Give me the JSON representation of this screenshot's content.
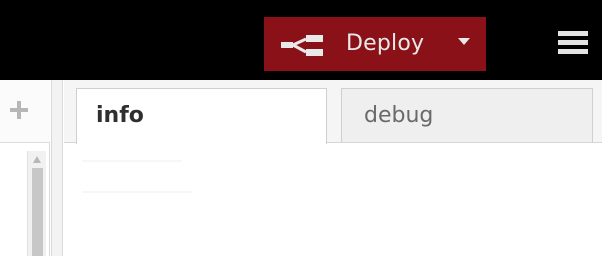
{
  "header": {
    "deploy": {
      "label": "Deploy",
      "icon": "deploy-icon",
      "dropdown_icon": "caret-down-icon",
      "background_color": "#8b1118"
    },
    "menu_icon": "hamburger-menu-icon",
    "background_color": "#000000"
  },
  "workspace": {
    "add_icon": "plus-icon",
    "scroll_up_icon": "scroll-up-icon"
  },
  "sidebar": {
    "tabs": [
      {
        "label": "info",
        "active": true
      },
      {
        "label": "debug",
        "active": false
      }
    ]
  }
}
